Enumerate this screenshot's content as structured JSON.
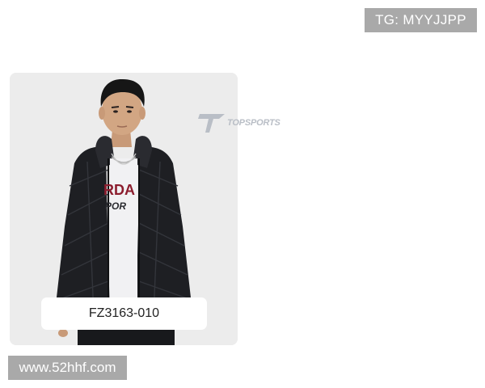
{
  "watermark_top": "TG: MYYJJPP",
  "product": {
    "sku": "FZ3163-010",
    "shirt_print_top": "RDA",
    "shirt_print_bottom": "POR"
  },
  "brand_logo": {
    "text": "TOPSPORTS",
    "icon": "topsports-logo-icon"
  },
  "watermark_bottom": "www.52hhf.com",
  "colors": {
    "jacket": "#1e1f23",
    "card_bg": "#ececec",
    "badge_bg": "#a9a9a9",
    "shirt_print": "#8c1d2e"
  }
}
